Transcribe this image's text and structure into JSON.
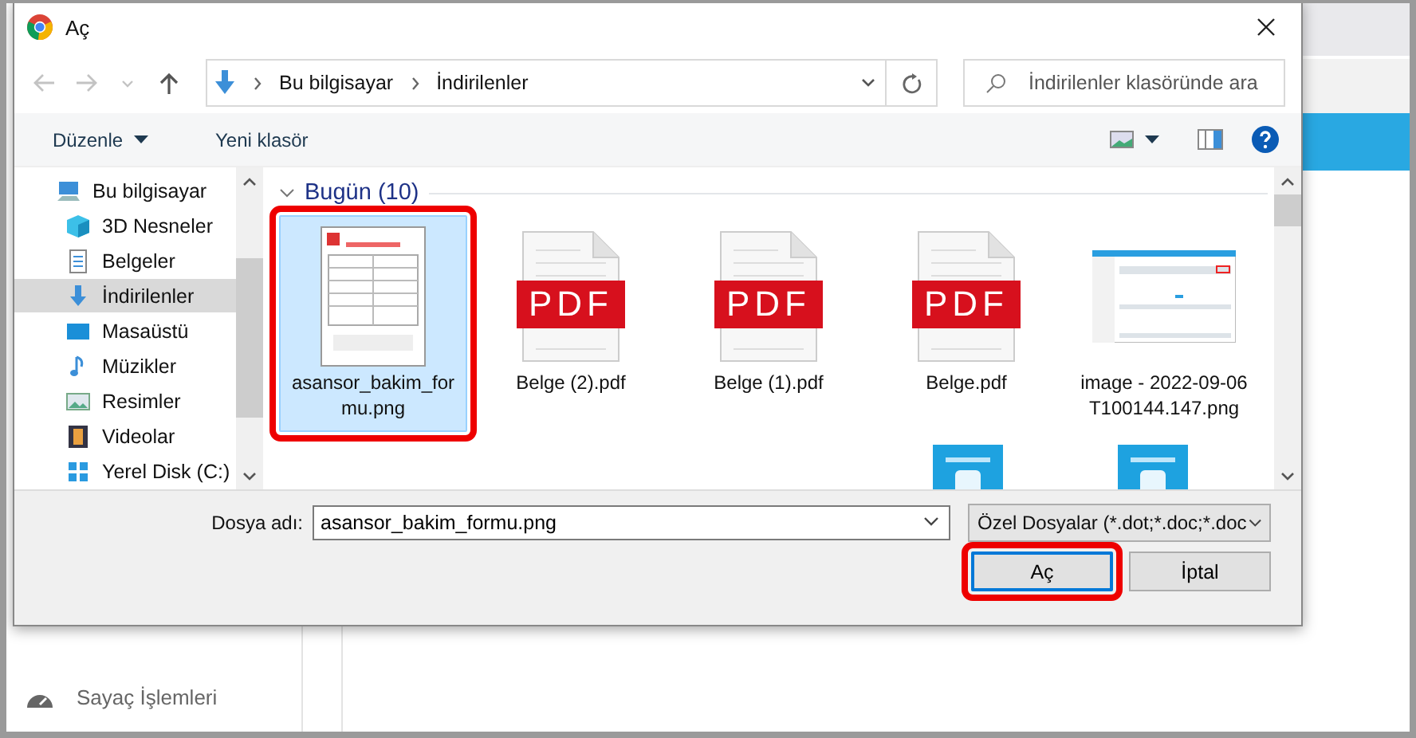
{
  "background_app": {
    "sidebar_items": [
      {
        "label": "Sayaç İşlemleri"
      }
    ]
  },
  "dialog": {
    "title": "Aç",
    "nav_buttons": [
      {
        "kind": "back",
        "disabled": true
      },
      {
        "kind": "forward",
        "disabled": true
      },
      {
        "kind": "recent",
        "disabled": true
      },
      {
        "kind": "up",
        "disabled": false
      }
    ],
    "address": [
      "Bu bilgisayar",
      "İndirilenler"
    ],
    "search": {
      "placeholder": "İndirilenler klasöründe ara"
    },
    "toolbar": {
      "organize": "Düzenle",
      "new_folder": "Yeni klasör"
    },
    "nav_pane": [
      {
        "label": "Bu bilgisayar",
        "kind": "pc",
        "selected": false
      },
      {
        "label": "3D Nesneler",
        "kind": "cube",
        "selected": false
      },
      {
        "label": "Belgeler",
        "kind": "docs",
        "selected": false
      },
      {
        "label": "İndirilenler",
        "kind": "download",
        "selected": true
      },
      {
        "label": "Masaüstü",
        "kind": "desktop",
        "selected": false
      },
      {
        "label": "Müzikler",
        "kind": "music",
        "selected": false
      },
      {
        "label": "Resimler",
        "kind": "pictures",
        "selected": false
      },
      {
        "label": "Videolar",
        "kind": "video",
        "selected": false
      },
      {
        "label": "Yerel Disk (C:)",
        "kind": "disk",
        "selected": false
      }
    ],
    "group": {
      "label": "Bugün (10)",
      "expanded": true
    },
    "files": [
      {
        "name": "asansor_bakim_formu.png",
        "kind": "form",
        "selected": true,
        "highlighted": true
      },
      {
        "name": "Belge (2).pdf",
        "kind": "pdf",
        "badge": "PDF",
        "selected": false,
        "highlighted": false
      },
      {
        "name": "Belge (1).pdf",
        "kind": "pdf",
        "badge": "PDF",
        "selected": false,
        "highlighted": false
      },
      {
        "name": "Belge.pdf",
        "kind": "pdf",
        "badge": "PDF",
        "selected": false,
        "highlighted": false
      },
      {
        "name": "image - 2022-09-06T100144.147.png",
        "kind": "screenshot",
        "selected": false,
        "highlighted": false
      }
    ],
    "file_name": {
      "label": "Dosya adı:",
      "value": "asansor_bakim_formu.png"
    },
    "file_type": "Özel Dosyalar (*.dot;*.doc;*.doc",
    "buttons": [
      {
        "label": "Aç",
        "kind": "default",
        "highlighted": true
      },
      {
        "label": "İptal",
        "kind": "normal",
        "highlighted": false
      }
    ]
  }
}
